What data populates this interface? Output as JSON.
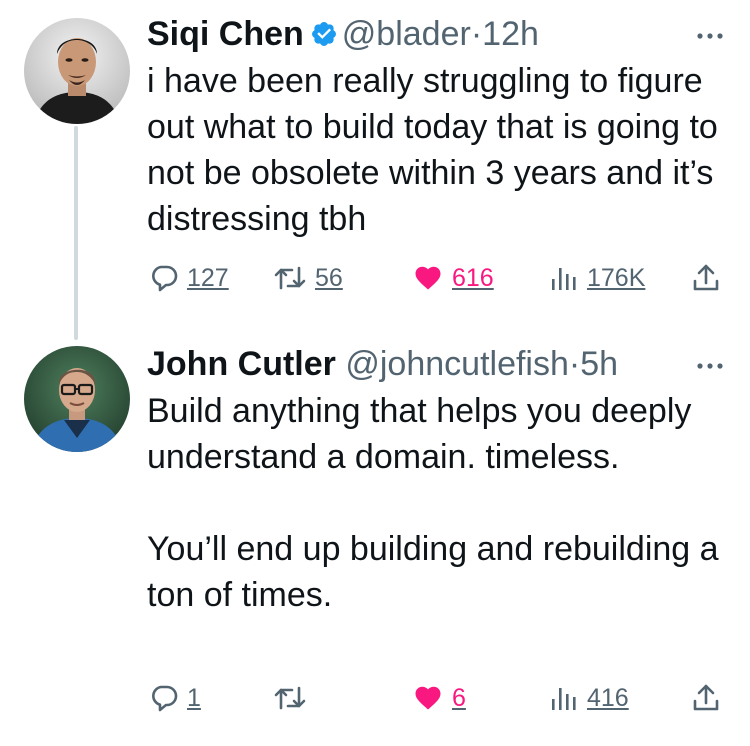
{
  "tweets": [
    {
      "author_name": "Siqi Chen",
      "verified": true,
      "handle": "@blader",
      "separator": "·",
      "time": "12h",
      "text": "i have been really struggling to figure out what to build today that is going to not be obsolete within 3 years and it’s distressing tbh",
      "replies": "127",
      "reposts": "56",
      "likes": "616",
      "views": "176K",
      "liked": true
    },
    {
      "author_name": "John Cutler",
      "verified": false,
      "handle": "@johncutlefish",
      "separator": "·",
      "time": "5h",
      "text": "Build anything that helps you deeply understand a domain. timeless.\n\nYou’ll end up building and rebuilding a ton of times.",
      "replies": "1",
      "reposts": "",
      "likes": "6",
      "views": "416",
      "liked": true
    }
  ],
  "colors": {
    "verified": "#1d9bf0",
    "like": "#f91880",
    "secondary_text": "#536471",
    "thread_line": "#cfd9de"
  },
  "icons": [
    "verified-badge-icon",
    "more-icon",
    "reply-icon",
    "repost-icon",
    "like-icon",
    "views-icon",
    "share-icon"
  ]
}
